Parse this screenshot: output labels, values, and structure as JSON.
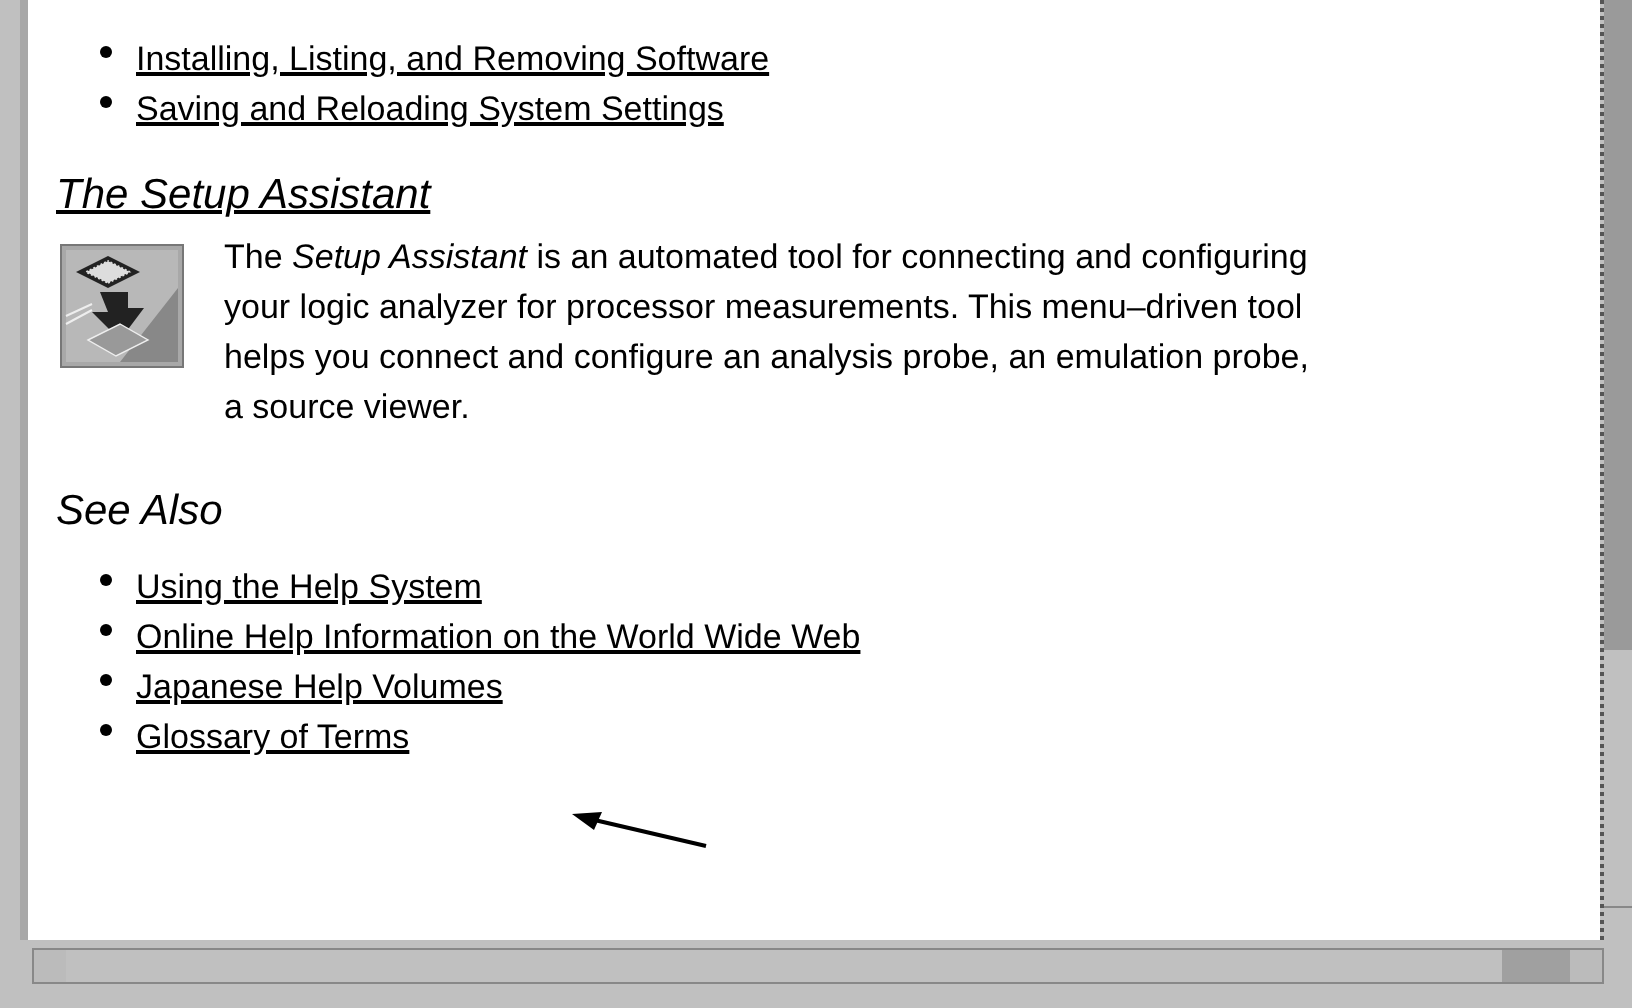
{
  "top_links": [
    "Installing, Listing, and Removing Software",
    "Saving and Reloading System Settings"
  ],
  "section": {
    "title": "The Setup Assistant",
    "lines": [
      "The *Setup Assistant* is an automated tool for connecting and configuring",
      "your logic analyzer for processor measurements. This menu–driven tool",
      "helps you connect and configure an analysis probe, an emulation probe,",
      "a source viewer."
    ]
  },
  "see_also": {
    "title": "See Also",
    "links": [
      "Using the Help System",
      "Online Help Information on the World Wide Web",
      "Japanese Help Volumes",
      "Glossary of Terms"
    ]
  }
}
